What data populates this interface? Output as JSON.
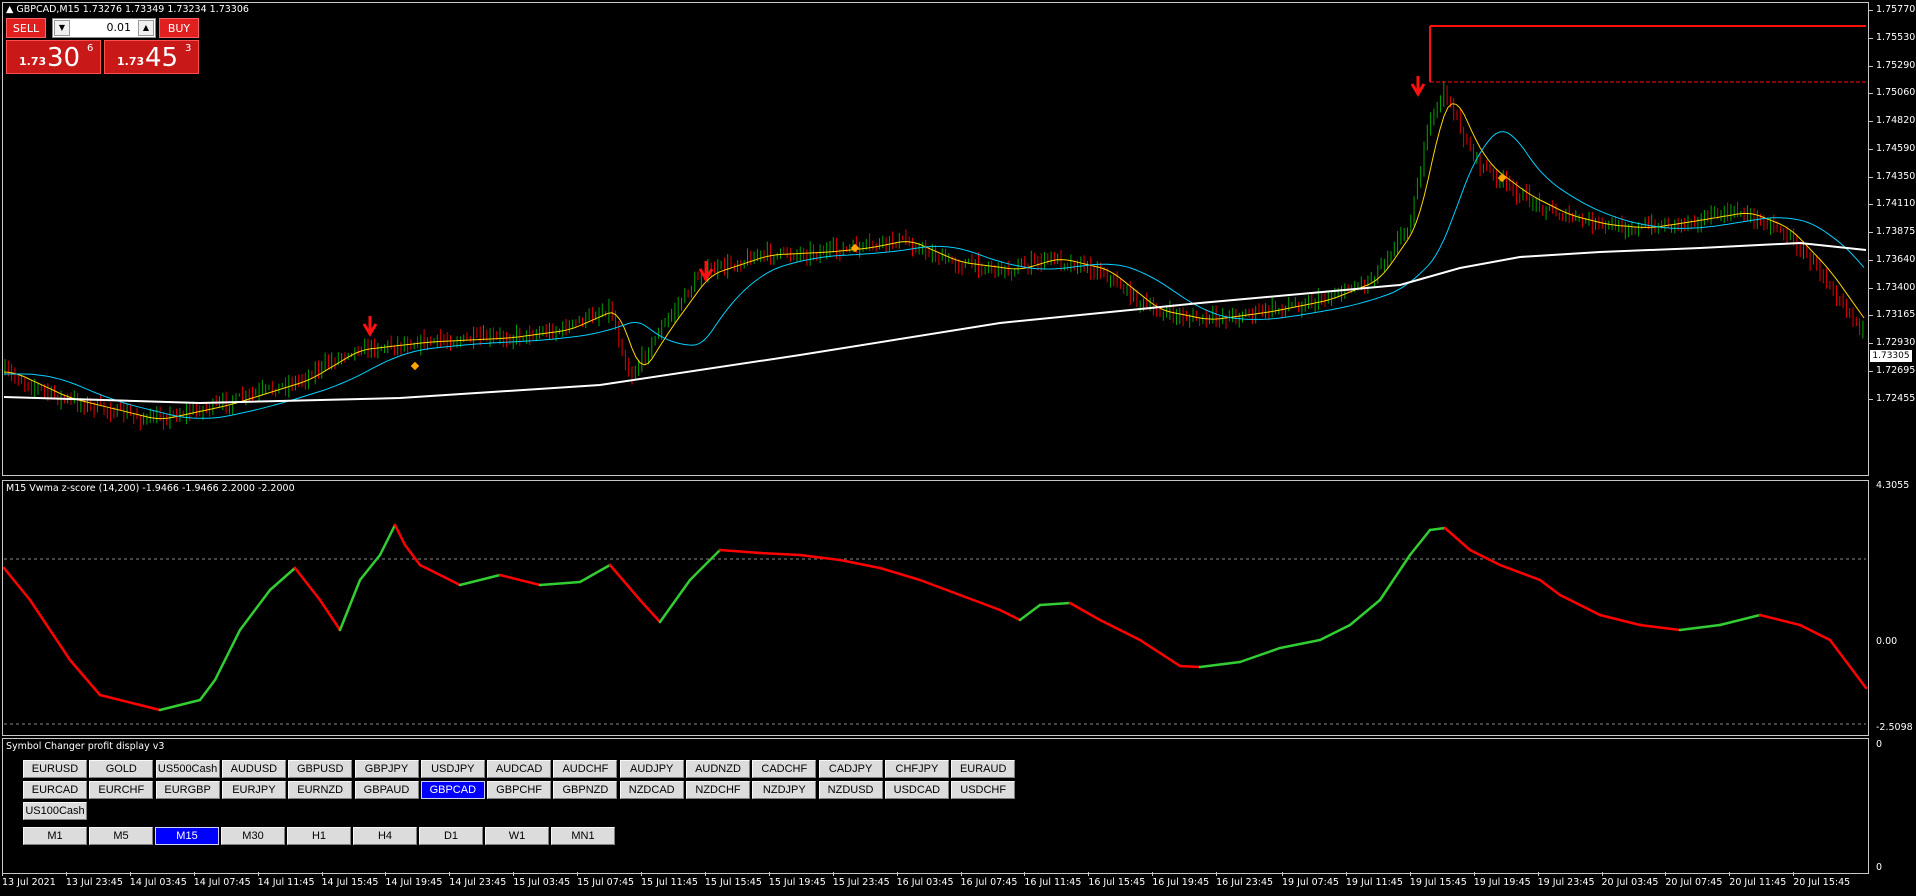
{
  "chart": {
    "header": "GBPCAD,M15  1.73276 1.73349 1.73234 1.73306",
    "current_price": "1.73305",
    "y_ticks": [
      "1.75770",
      "1.75530",
      "1.75290",
      "1.75060",
      "1.74820",
      "1.74590",
      "1.74350",
      "1.74110",
      "1.73875",
      "1.73640",
      "1.73400",
      "1.73165",
      "1.72930",
      "1.72695",
      "1.72455"
    ]
  },
  "trade_panel": {
    "sell_label": "SELL",
    "buy_label": "BUY",
    "lot_value": "0.01",
    "sell_price_prefix": "1.73",
    "sell_price_big": "30",
    "sell_price_sup": "6",
    "buy_price_prefix": "1.73",
    "buy_price_big": "45",
    "buy_price_sup": "3"
  },
  "indicator": {
    "header": "M15 Vwma z-score (14,200) -1.9466 -1.9466 2.2000 -2.2000",
    "y_ticks": [
      "4.3055",
      "0.00",
      "-2.5098"
    ]
  },
  "symbol_panel": {
    "header": "Symbol Changer profit display v3",
    "y_ticks": [
      "0",
      "0"
    ],
    "row1": [
      "EURUSD",
      "GOLD",
      "US500Cash",
      "AUDUSD",
      "GBPUSD",
      "GBPJPY",
      "USDJPY",
      "AUDCAD",
      "AUDCHF",
      "AUDJPY",
      "AUDNZD",
      "CADCHF",
      "CADJPY",
      "CHFJPY",
      "EURAUD"
    ],
    "row2": [
      "EURCAD",
      "EURCHF",
      "EURGBP",
      "EURJPY",
      "EURNZD",
      "GBPAUD",
      "GBPCAD",
      "GBPCHF",
      "GBPNZD",
      "NZDCAD",
      "NZDCHF",
      "NZDJPY",
      "NZDUSD",
      "USDCAD",
      "USDCHF"
    ],
    "row3": [
      "US100Cash"
    ],
    "active_symbol": "GBPCAD",
    "timeframes": [
      "M1",
      "M5",
      "M15",
      "M30",
      "H1",
      "H4",
      "D1",
      "W1",
      "MN1"
    ],
    "active_timeframe": "M15"
  },
  "x_ticks": [
    "13 Jul 2021",
    "13 Jul 23:45",
    "14 Jul 03:45",
    "14 Jul 07:45",
    "14 Jul 11:45",
    "14 Jul 15:45",
    "14 Jul 19:45",
    "14 Jul 23:45",
    "15 Jul 03:45",
    "15 Jul 07:45",
    "15 Jul 11:45",
    "15 Jul 15:45",
    "15 Jul 19:45",
    "15 Jul 23:45",
    "16 Jul 03:45",
    "16 Jul 07:45",
    "16 Jul 11:45",
    "16 Jul 15:45",
    "16 Jul 19:45",
    "16 Jul 23:45",
    "19 Jul 07:45",
    "19 Jul 11:45",
    "19 Jul 15:45",
    "19 Jul 19:45",
    "19 Jul 23:45",
    "20 Jul 03:45",
    "20 Jul 07:45",
    "20 Jul 11:45",
    "20 Jul 15:45"
  ],
  "colors": {
    "background": "#000000",
    "bull_candle": "#00a000",
    "bear_candle": "#e00000",
    "fast_ma": "#ffd700",
    "mid_ma": "#00d0ff",
    "slow_ma": "#ffffff",
    "zscore_up": "#32cd32",
    "zscore_down": "#ff0000",
    "active_button": "#0000ff"
  }
}
